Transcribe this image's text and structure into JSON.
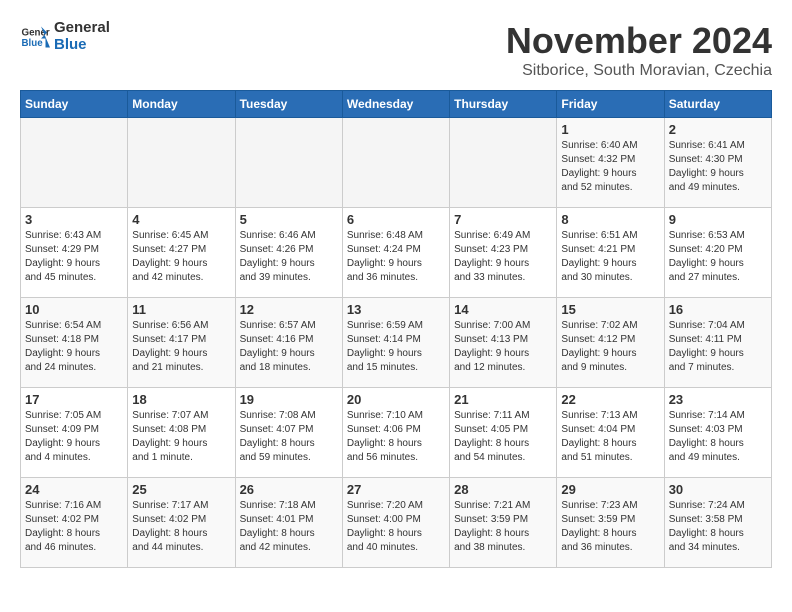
{
  "header": {
    "logo_general": "General",
    "logo_blue": "Blue",
    "month": "November 2024",
    "location": "Sitborice, South Moravian, Czechia"
  },
  "weekdays": [
    "Sunday",
    "Monday",
    "Tuesday",
    "Wednesday",
    "Thursday",
    "Friday",
    "Saturday"
  ],
  "weeks": [
    [
      {
        "day": "",
        "info": ""
      },
      {
        "day": "",
        "info": ""
      },
      {
        "day": "",
        "info": ""
      },
      {
        "day": "",
        "info": ""
      },
      {
        "day": "",
        "info": ""
      },
      {
        "day": "1",
        "info": "Sunrise: 6:40 AM\nSunset: 4:32 PM\nDaylight: 9 hours\nand 52 minutes."
      },
      {
        "day": "2",
        "info": "Sunrise: 6:41 AM\nSunset: 4:30 PM\nDaylight: 9 hours\nand 49 minutes."
      }
    ],
    [
      {
        "day": "3",
        "info": "Sunrise: 6:43 AM\nSunset: 4:29 PM\nDaylight: 9 hours\nand 45 minutes."
      },
      {
        "day": "4",
        "info": "Sunrise: 6:45 AM\nSunset: 4:27 PM\nDaylight: 9 hours\nand 42 minutes."
      },
      {
        "day": "5",
        "info": "Sunrise: 6:46 AM\nSunset: 4:26 PM\nDaylight: 9 hours\nand 39 minutes."
      },
      {
        "day": "6",
        "info": "Sunrise: 6:48 AM\nSunset: 4:24 PM\nDaylight: 9 hours\nand 36 minutes."
      },
      {
        "day": "7",
        "info": "Sunrise: 6:49 AM\nSunset: 4:23 PM\nDaylight: 9 hours\nand 33 minutes."
      },
      {
        "day": "8",
        "info": "Sunrise: 6:51 AM\nSunset: 4:21 PM\nDaylight: 9 hours\nand 30 minutes."
      },
      {
        "day": "9",
        "info": "Sunrise: 6:53 AM\nSunset: 4:20 PM\nDaylight: 9 hours\nand 27 minutes."
      }
    ],
    [
      {
        "day": "10",
        "info": "Sunrise: 6:54 AM\nSunset: 4:18 PM\nDaylight: 9 hours\nand 24 minutes."
      },
      {
        "day": "11",
        "info": "Sunrise: 6:56 AM\nSunset: 4:17 PM\nDaylight: 9 hours\nand 21 minutes."
      },
      {
        "day": "12",
        "info": "Sunrise: 6:57 AM\nSunset: 4:16 PM\nDaylight: 9 hours\nand 18 minutes."
      },
      {
        "day": "13",
        "info": "Sunrise: 6:59 AM\nSunset: 4:14 PM\nDaylight: 9 hours\nand 15 minutes."
      },
      {
        "day": "14",
        "info": "Sunrise: 7:00 AM\nSunset: 4:13 PM\nDaylight: 9 hours\nand 12 minutes."
      },
      {
        "day": "15",
        "info": "Sunrise: 7:02 AM\nSunset: 4:12 PM\nDaylight: 9 hours\nand 9 minutes."
      },
      {
        "day": "16",
        "info": "Sunrise: 7:04 AM\nSunset: 4:11 PM\nDaylight: 9 hours\nand 7 minutes."
      }
    ],
    [
      {
        "day": "17",
        "info": "Sunrise: 7:05 AM\nSunset: 4:09 PM\nDaylight: 9 hours\nand 4 minutes."
      },
      {
        "day": "18",
        "info": "Sunrise: 7:07 AM\nSunset: 4:08 PM\nDaylight: 9 hours\nand 1 minute."
      },
      {
        "day": "19",
        "info": "Sunrise: 7:08 AM\nSunset: 4:07 PM\nDaylight: 8 hours\nand 59 minutes."
      },
      {
        "day": "20",
        "info": "Sunrise: 7:10 AM\nSunset: 4:06 PM\nDaylight: 8 hours\nand 56 minutes."
      },
      {
        "day": "21",
        "info": "Sunrise: 7:11 AM\nSunset: 4:05 PM\nDaylight: 8 hours\nand 54 minutes."
      },
      {
        "day": "22",
        "info": "Sunrise: 7:13 AM\nSunset: 4:04 PM\nDaylight: 8 hours\nand 51 minutes."
      },
      {
        "day": "23",
        "info": "Sunrise: 7:14 AM\nSunset: 4:03 PM\nDaylight: 8 hours\nand 49 minutes."
      }
    ],
    [
      {
        "day": "24",
        "info": "Sunrise: 7:16 AM\nSunset: 4:02 PM\nDaylight: 8 hours\nand 46 minutes."
      },
      {
        "day": "25",
        "info": "Sunrise: 7:17 AM\nSunset: 4:02 PM\nDaylight: 8 hours\nand 44 minutes."
      },
      {
        "day": "26",
        "info": "Sunrise: 7:18 AM\nSunset: 4:01 PM\nDaylight: 8 hours\nand 42 minutes."
      },
      {
        "day": "27",
        "info": "Sunrise: 7:20 AM\nSunset: 4:00 PM\nDaylight: 8 hours\nand 40 minutes."
      },
      {
        "day": "28",
        "info": "Sunrise: 7:21 AM\nSunset: 3:59 PM\nDaylight: 8 hours\nand 38 minutes."
      },
      {
        "day": "29",
        "info": "Sunrise: 7:23 AM\nSunset: 3:59 PM\nDaylight: 8 hours\nand 36 minutes."
      },
      {
        "day": "30",
        "info": "Sunrise: 7:24 AM\nSunset: 3:58 PM\nDaylight: 8 hours\nand 34 minutes."
      }
    ]
  ]
}
